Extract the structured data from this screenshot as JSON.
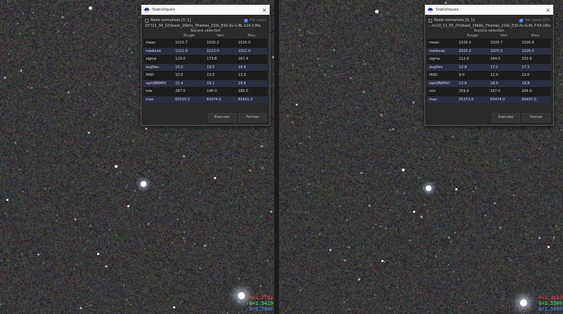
{
  "left_dialog": {
    "title": "Statistiques",
    "normalized_label": "Réels normalisés [0, 1]",
    "per_channel_label": "Par canal",
    "filename": "15\"\\11_34_10\\Stack_16bits_7frames_210s_E30.0s-G-BL-114.3.fits",
    "selection_label": "Aucune sélection",
    "columns": [
      "",
      "Rouge",
      "Vert",
      "Bleu"
    ],
    "rows": [
      {
        "label": "mean",
        "r": "1025.7",
        "g": "1026.2",
        "b": "1026.0"
      },
      {
        "label": "médiane",
        "r": "1022.0",
        "g": "1023.0",
        "b": "1022.0"
      },
      {
        "label": "sigma",
        "r": "129.0",
        "g": "173.8",
        "b": "167.4"
      },
      {
        "label": "avgDev",
        "r": "16.0",
        "g": "19.5",
        "b": "19.9"
      },
      {
        "label": "MAD",
        "r": "10.0",
        "g": "13.0",
        "b": "13.0"
      },
      {
        "label": "sqrt(BWMV)",
        "r": "15.4",
        "g": "19.1",
        "b": "19.8"
      },
      {
        "label": "min",
        "r": "287.0",
        "g": "148.0",
        "b": "180.0"
      },
      {
        "label": "max",
        "r": "65535.0",
        "g": "65474.0",
        "b": "65451.0"
      }
    ],
    "execute_label": "Exécuter",
    "close_label": "Fermer"
  },
  "right_dialog": {
    "title": "Statistiques",
    "normalized_label": "Réels normalisés [0, 1]",
    "per_channel_label": "Par canal (CF)",
    "filename": "...m\\10_11_05_25\\Stack_16bits_7frames_210s_E30.0s-G-BL-T-59.1fits",
    "selection_label": "Aucune sélection",
    "columns": [
      "",
      "Rouge",
      "Vert",
      "Bleu"
    ],
    "rows": [
      {
        "label": "mean",
        "r": "1026.0",
        "g": "1026.7",
        "b": "1026.9"
      },
      {
        "label": "médiane",
        "r": "1025.0",
        "g": "1025.0",
        "b": "1026.0"
      },
      {
        "label": "sigma",
        "r": "112.0",
        "g": "164.5",
        "b": "152.9"
      },
      {
        "label": "avgDev",
        "r": "12.9",
        "g": "17.2",
        "b": "17.3"
      },
      {
        "label": "MAD",
        "r": "9.0",
        "g": "12.0",
        "b": "12.0"
      },
      {
        "label": "sqrt(BWMV)",
        "r": "13.9",
        "g": "18.5",
        "b": "18.8"
      },
      {
        "label": "min",
        "r": "259.0",
        "g": "167.0",
        "b": "204.0"
      },
      {
        "label": "max",
        "r": "65373.0",
        "g": "65474.0",
        "b": "65497.0"
      }
    ],
    "execute_label": "Exécuter",
    "close_label": "Fermer"
  },
  "left_corner": {
    "r": "R=1.2702",
    "g": "G=1.5419",
    "b": "B=1.5000"
  },
  "right_corner": {
    "r": "R=1.2683",
    "g": "G=1.5589",
    "b": "B=1.5000"
  }
}
